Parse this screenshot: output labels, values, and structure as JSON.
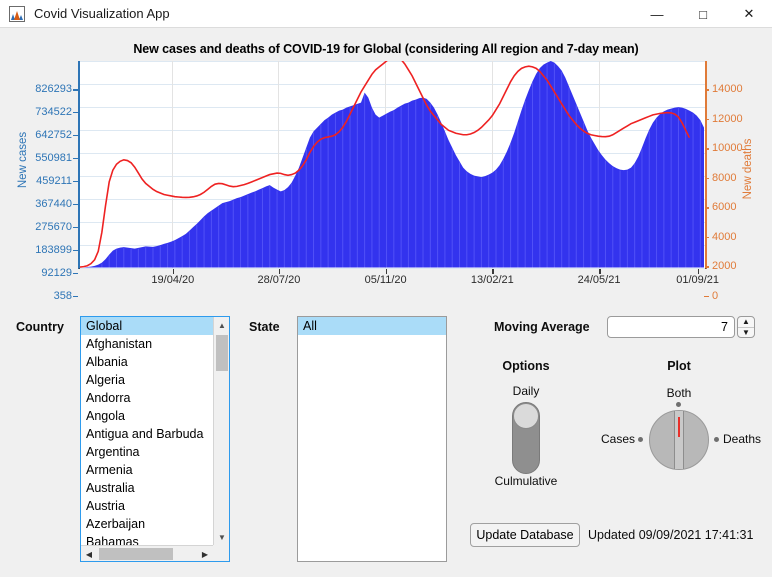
{
  "window": {
    "title": "Covid Visualization App",
    "icon": "matlab-app-icon",
    "minimize": "—",
    "maximize": "□",
    "close": "✕"
  },
  "chart": {
    "title": "New cases and deaths of COVID-19 for Global (considering All region and 7-day mean)",
    "y_left_label": "New cases",
    "y_right_label": "New deaths",
    "left_axis_color": "#2e75b6",
    "right_axis_color": "#e07b39",
    "bar_color": "#3333ee",
    "line_color": "#ee2222"
  },
  "chart_data": {
    "type": "bar",
    "title": "New cases and deaths of COVID-19 for Global (considering All region and 7-day mean)",
    "xlabel": "",
    "ylabel": "New cases",
    "y2label": "New deaths",
    "grid": true,
    "legend": "none",
    "ylim": [
      358,
      826293
    ],
    "y2lim": [
      0,
      14000
    ],
    "yticks": [
      358,
      92129,
      183899,
      275670,
      367440,
      459211,
      550981,
      642752,
      734522,
      826293
    ],
    "ytick_labels": [
      "358",
      "92129",
      "183899",
      "275670",
      "367440",
      "459211",
      "550981",
      "642752",
      "734522",
      "826293"
    ],
    "y2ticks": [
      0,
      2000,
      4000,
      6000,
      8000,
      10000,
      12000,
      14000
    ],
    "y2tick_labels": [
      "0",
      "2000",
      "4000",
      "6000",
      "8000",
      "10000",
      "12000",
      "14000"
    ],
    "xtick_labels": [
      "19/04/20",
      "28/07/20",
      "05/11/20",
      "13/02/21",
      "24/05/21",
      "01/09/21"
    ],
    "xtick_positions": [
      0.148,
      0.318,
      0.489,
      0.66,
      0.831,
      0.989
    ],
    "series": [
      {
        "name": "New cases",
        "type": "bar",
        "axis": "left",
        "color": "#3333ee",
        "values": [
          1000,
          1500,
          2500,
          4000,
          7000,
          12000,
          20000,
          34000,
          52000,
          68000,
          76000,
          80000,
          82000,
          80000,
          78000,
          76000,
          79000,
          82000,
          85000,
          84000,
          83000,
          86000,
          90000,
          95000,
          99000,
          104000,
          110000,
          118000,
          126000,
          135000,
          148000,
          162000,
          175000,
          190000,
          205000,
          218000,
          228000,
          238000,
          248000,
          258000,
          262000,
          266000,
          272000,
          278000,
          282000,
          288000,
          294000,
          300000,
          305000,
          312000,
          318000,
          325000,
          330000,
          320000,
          312000,
          305000,
          310000,
          322000,
          340000,
          368000,
          400000,
          440000,
          480000,
          520000,
          545000,
          560000,
          575000,
          590000,
          600000,
          612000,
          620000,
          628000,
          632000,
          640000,
          645000,
          650000,
          655000,
          660000,
          700000,
          680000,
          640000,
          612000,
          600000,
          608000,
          616000,
          624000,
          630000,
          640000,
          648000,
          656000,
          660000,
          668000,
          672000,
          678000,
          680000,
          675000,
          660000,
          640000,
          612000,
          580000,
          545000,
          510000,
          480000,
          450000,
          425000,
          400000,
          385000,
          375000,
          368000,
          365000,
          362000,
          366000,
          372000,
          380000,
          392000,
          410000,
          435000,
          465000,
          500000,
          540000,
          585000,
          630000,
          672000,
          710000,
          745000,
          775000,
          798000,
          812000,
          820000,
          826293,
          820000,
          806000,
          788000,
          760000,
          725000,
          690000,
          655000,
          620000,
          585000,
          550000,
          520000,
          495000,
          470000,
          450000,
          432000,
          418000,
          406000,
          398000,
          392000,
          390000,
          392000,
          400000,
          418000,
          445000,
          480000,
          518000,
          552000,
          580000,
          600000,
          615000,
          625000,
          632000,
          636000,
          640000,
          642000,
          640000,
          635000,
          628000,
          620000,
          608000,
          590000,
          560000
        ],
        "peak_value": 826293,
        "peak_date": "2021-04-28"
      },
      {
        "name": "New deaths",
        "type": "line",
        "axis": "right",
        "color": "#ee2222",
        "values": [
          30,
          60,
          120,
          260,
          520,
          1100,
          2400,
          4200,
          5800,
          6600,
          7000,
          7200,
          7300,
          7250,
          7100,
          6800,
          6400,
          6000,
          5700,
          5500,
          5300,
          5150,
          5050,
          4950,
          4900,
          4850,
          4800,
          4780,
          4760,
          4750,
          4760,
          4790,
          4850,
          4950,
          5100,
          5300,
          5500,
          5650,
          5700,
          5680,
          5600,
          5520,
          5480,
          5500,
          5560,
          5620,
          5700,
          5800,
          5900,
          6000,
          6100,
          6200,
          6300,
          6350,
          6400,
          6380,
          6300,
          6250,
          6300,
          6400,
          6600,
          6900,
          7300,
          7800,
          8200,
          8500,
          8700,
          8800,
          8850,
          8900,
          9000,
          9200,
          9500,
          9900,
          10400,
          10900,
          11400,
          11900,
          12300,
          12700,
          13100,
          13400,
          13600,
          13800,
          14000,
          14200,
          14350,
          14300,
          14100,
          13800,
          13400,
          13000,
          12500,
          12000,
          11500,
          11000,
          10600,
          10300,
          10000,
          9700,
          9500,
          9300,
          9200,
          9100,
          9050,
          9000,
          9000,
          9050,
          9150,
          9300,
          9500,
          9750,
          10000,
          10300,
          10700,
          11100,
          11600,
          12100,
          12600,
          13000,
          13300,
          13500,
          13600,
          13650,
          13600,
          13500,
          13300,
          13000,
          12700,
          12300,
          11900,
          11500,
          11100,
          10700,
          10300,
          10000,
          9700,
          9450,
          9250,
          9100,
          9000,
          8950,
          8900,
          8880,
          8870,
          8900,
          9000,
          9150,
          9300,
          9450,
          9600,
          9750,
          9850,
          9950,
          10050,
          10150,
          10250,
          10350,
          10400,
          10450,
          10480,
          10500,
          10480,
          10400,
          10200,
          9800,
          9300,
          8800
        ],
        "peak_value": 14350
      }
    ]
  },
  "controls": {
    "country_label": "Country",
    "country_items": [
      "Global",
      "Afghanistan",
      "Albania",
      "Algeria",
      "Andorra",
      "Angola",
      "Antigua and Barbuda",
      "Argentina",
      "Armenia",
      "Australia",
      "Austria",
      "Azerbaijan",
      "Bahamas"
    ],
    "country_selected": "Global",
    "state_label": "State",
    "state_items": [
      "All"
    ],
    "state_selected": "All",
    "moving_average_label": "Moving Average",
    "moving_average_value": "7",
    "spin_up_icon": "▲",
    "spin_down_icon": "▼",
    "scroll_up_icon": "▲",
    "scroll_down_icon": "▼",
    "scroll_left_icon": "◀",
    "scroll_right_icon": "▶",
    "options_title": "Options",
    "options_top": "Daily",
    "options_bottom": "Culmulative",
    "options_selected": "Daily",
    "plot_title": "Plot",
    "plot_top": "Both",
    "plot_left": "Cases",
    "plot_right": "Deaths",
    "plot_selected": "Both",
    "update_button": "Update Database",
    "status": "Updated 09/09/2021 17:41:31"
  }
}
